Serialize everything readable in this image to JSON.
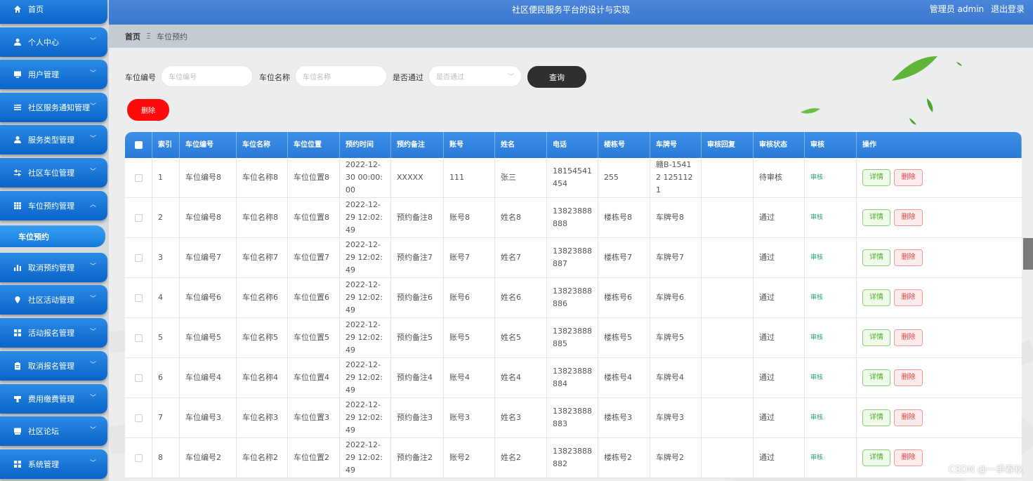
{
  "header": {
    "title": "社区便民服务平台的设计与实现",
    "user": "管理员 admin",
    "logout": "退出登录"
  },
  "breadcrumb": {
    "home": "首页",
    "current": "车位预约"
  },
  "sidebar": {
    "items": [
      {
        "label": "首页",
        "icon": "home-icon"
      },
      {
        "label": "个人中心",
        "icon": "user-icon"
      },
      {
        "label": "用户管理",
        "icon": "monitor-icon"
      },
      {
        "label": "社区服务通知管理",
        "icon": "list-icon"
      },
      {
        "label": "服务类型管理",
        "icon": "user-icon"
      },
      {
        "label": "社区车位管理",
        "icon": "sliders-icon"
      },
      {
        "label": "车位预约管理",
        "icon": "grid-icon"
      },
      {
        "label": "取消预约管理",
        "icon": "bar-chart-icon"
      },
      {
        "label": "社区活动管理",
        "icon": "location-pin-icon"
      },
      {
        "label": "活动报名管理",
        "icon": "apps-icon"
      },
      {
        "label": "取消报名管理",
        "icon": "clipboard-icon"
      },
      {
        "label": "费用缴费管理",
        "icon": "money-icon"
      },
      {
        "label": "社区论坛",
        "icon": "chat-icon"
      },
      {
        "label": "系统管理",
        "icon": "apps-icon"
      }
    ],
    "active_sub": "车位预约"
  },
  "search": {
    "f1_label": "车位编号",
    "f1_placeholder": "车位编号",
    "f2_label": "车位名称",
    "f2_placeholder": "车位名称",
    "f3_label": "是否通过",
    "f3_placeholder": "是否通过",
    "query": "查询",
    "delete": "删除"
  },
  "table": {
    "headers": [
      "索引",
      "车位编号",
      "车位名称",
      "车位位置",
      "预约时间",
      "预约备注",
      "账号",
      "姓名",
      "电话",
      "楼栋号",
      "车牌号",
      "审核回复",
      "审核状态",
      "审核",
      "操作"
    ],
    "audit_label": "审核",
    "detail_label": "详情",
    "delete_label": "删除",
    "rows": [
      [
        "1",
        "车位编号8",
        "车位名称8",
        "车位位置8",
        "2022-12-30 00:00:00",
        "XXXXX",
        "111",
        "张三",
        "18154541454",
        "255",
        "赣B-15412 1251121",
        "",
        "待审核"
      ],
      [
        "2",
        "车位编号8",
        "车位名称8",
        "车位位置8",
        "2022-12-29 12:02:49",
        "预约备注8",
        "账号8",
        "姓名8",
        "13823888888",
        "楼栋号8",
        "车牌号8",
        "",
        "通过"
      ],
      [
        "3",
        "车位编号7",
        "车位名称7",
        "车位位置7",
        "2022-12-29 12:02:49",
        "预约备注7",
        "账号7",
        "姓名7",
        "13823888887",
        "楼栋号7",
        "车牌号7",
        "",
        "通过"
      ],
      [
        "4",
        "车位编号6",
        "车位名称6",
        "车位位置6",
        "2022-12-29 12:02:49",
        "预约备注6",
        "账号6",
        "姓名6",
        "13823888886",
        "楼栋号6",
        "车牌号6",
        "",
        "通过"
      ],
      [
        "5",
        "车位编号5",
        "车位名称5",
        "车位位置5",
        "2022-12-29 12:02:49",
        "预约备注5",
        "账号5",
        "姓名5",
        "13823888885",
        "楼栋号5",
        "车牌号5",
        "",
        "通过"
      ],
      [
        "6",
        "车位编号4",
        "车位名称4",
        "车位位置4",
        "2022-12-29 12:02:49",
        "预约备注4",
        "账号4",
        "姓名4",
        "13823888884",
        "楼栋号4",
        "车牌号4",
        "",
        "通过"
      ],
      [
        "7",
        "车位编号3",
        "车位名称3",
        "车位位置3",
        "2022-12-29 12:02:49",
        "预约备注3",
        "账号3",
        "姓名3",
        "13823888883",
        "楼栋号3",
        "车牌号3",
        "",
        "通过"
      ],
      [
        "8",
        "车位编号2",
        "车位名称2",
        "车位位置2",
        "2022-12-29 12:02:49",
        "预约备注2",
        "账号2",
        "姓名2",
        "13823888882",
        "楼栋号2",
        "车牌号2",
        "",
        "通过"
      ]
    ]
  },
  "watermark": "CSDN @一季春秋",
  "colors": {
    "accent": "#1a73d9",
    "header": "#3f7fd6",
    "danger": "#ff0b0b"
  }
}
